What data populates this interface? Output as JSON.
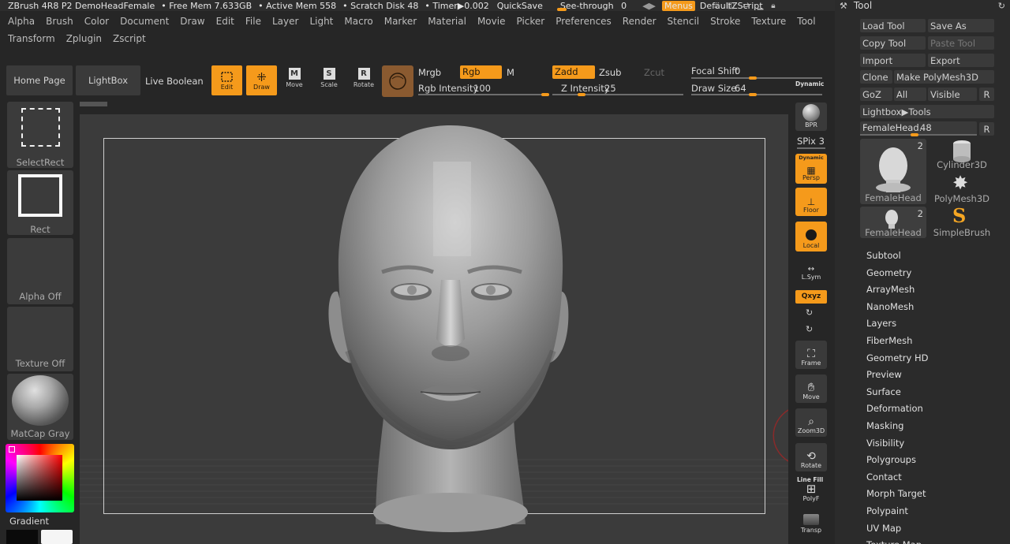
{
  "titlebar": {
    "app": "ZBrush 4R8 P2 DemoHeadFemale",
    "free_mem": "• Free Mem 7.633GB",
    "active_mem": "• Active Mem 558",
    "scratch": "• Scratch Disk 48",
    "timer": "• Timer▶0.002",
    "quicksave": "QuickSave",
    "seethrough": "See-through",
    "seethrough_val": "0",
    "menus": "Menus",
    "script": "DefaultZScript"
  },
  "menu_row1": [
    "Alpha",
    "Brush",
    "Color",
    "Document",
    "Draw",
    "Edit",
    "File",
    "Layer",
    "Light",
    "Macro",
    "Marker",
    "Material",
    "Movie",
    "Picker",
    "Preferences",
    "Render",
    "Stencil",
    "Stroke",
    "Texture",
    "Tool"
  ],
  "menu_row2": [
    "Transform",
    "Zplugin",
    "Zscript"
  ],
  "toolbar": {
    "home": "Home Page",
    "lightbox": "LightBox",
    "liveboolean": "Live Boolean",
    "edit": "Edit",
    "draw": "Draw",
    "move": "Move",
    "scale": "Scale",
    "rotate": "Rotate",
    "mrgb": "Mrgb",
    "rgb": "Rgb",
    "m": "M",
    "rgb_intensity_label": "Rgb Intensity",
    "rgb_intensity": "100",
    "zadd": "Zadd",
    "zsub": "Zsub",
    "zcut": "Zcut",
    "z_intensity_label": "Z Intensity",
    "z_intensity": "25",
    "focal_label": "Focal Shift",
    "focal_val": "0",
    "drawsize_label": "Draw Size",
    "drawsize_val": "64",
    "dynamic": "Dynamic"
  },
  "slider_levels": {
    "rgb_intensity": 1.0,
    "z_intensity": 0.25,
    "focal_shift": 0.5,
    "draw_size": 0.5,
    "femalehead": 0.5
  },
  "left_shelf": {
    "selectrect": "SelectRect",
    "rect": "Rect",
    "alpha": "Alpha Off",
    "texture": "Texture Off",
    "matcap": "MatCap Gray",
    "gradient": "Gradient"
  },
  "right_shelf": {
    "bpr": "BPR",
    "spix": "SPix 3",
    "dynamic": "Dynamic",
    "persp": "Persp",
    "floor": "Floor",
    "local": "Local",
    "lsym": "L.Sym",
    "xyz": "Qxyz",
    "frame": "Frame",
    "move": "Move",
    "zoom3d": "Zoom3D",
    "rotate": "Rotate",
    "linefill": "Line Fill",
    "polyf": "PolyF",
    "transp": "Transp"
  },
  "tool_panel": {
    "title": "Tool",
    "load": "Load Tool",
    "saveas": "Save As",
    "copy": "Copy Tool",
    "paste": "Paste Tool",
    "import": "Import",
    "export": "Export",
    "clone": "Clone",
    "makepoly": "Make PolyMesh3D",
    "goz": "GoZ",
    "all": "All",
    "visible": "Visible",
    "r": "R",
    "lightbox_tools": "Lightbox▶Tools",
    "femalehead_label": "FemaleHead.",
    "femalehead_val": "48",
    "thumb1": "FemaleHead",
    "thumb1_count": "2",
    "thumb2": "Cylinder3D",
    "thumb3": "PolyMesh3D",
    "thumb4": "FemaleHead",
    "thumb4_count": "2",
    "thumb5": "SimpleBrush",
    "subpalettes": [
      "Subtool",
      "Geometry",
      "ArrayMesh",
      "NanoMesh",
      "Layers",
      "FiberMesh",
      "Geometry HD",
      "Preview",
      "Surface",
      "Deformation",
      "Masking",
      "Visibility",
      "Polygroups",
      "Contact",
      "Morph Target",
      "Polypaint",
      "UV Map",
      "Texture Map"
    ]
  },
  "colors": {
    "accent": "#f59a1b",
    "bg": "#262626",
    "panel": "#2e2e2e"
  }
}
